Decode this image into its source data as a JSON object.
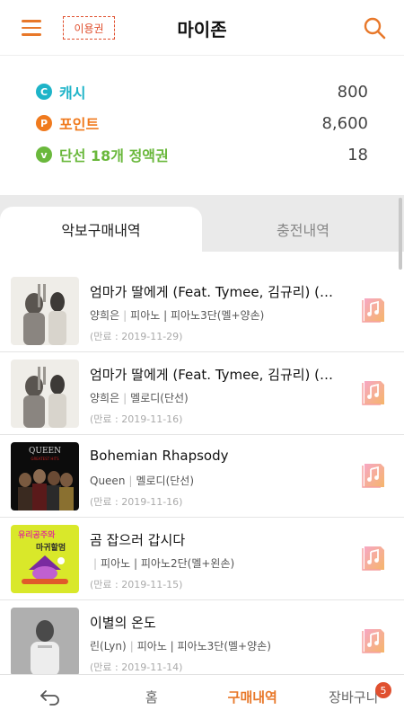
{
  "header": {
    "title": "마이존",
    "voucher_label": "이용권",
    "menu_icon": "hamburger-menu-icon",
    "search_icon": "search-icon",
    "accent": "#e8782a"
  },
  "balance": [
    {
      "icon_letter": "C",
      "label": "캐시",
      "value": "800",
      "color": "#1eb4c8"
    },
    {
      "icon_letter": "P",
      "label": "포인트",
      "value": "8,600",
      "color": "#f07a1e"
    },
    {
      "icon_letter": "v",
      "label": "단선 18개 정액권",
      "value": "18",
      "color": "#6ab83c"
    }
  ],
  "tabs": [
    {
      "label": "악보구매내역",
      "active": true
    },
    {
      "label": "충전내역",
      "active": false
    }
  ],
  "purchases": [
    {
      "title": "엄마가 딸에게 (Feat. Tymee, 김규리) (Ra…",
      "artist": "양희은",
      "meta": "피아노 | 피아노3단(멜+양손)",
      "date": "(만료 : 2019-11-29)",
      "thumb": "album-yang-icon"
    },
    {
      "title": "엄마가 딸에게 (Feat. Tymee, 김규리) (Ra…",
      "artist": "양희은",
      "meta": "멜로디(단선)",
      "date": "(만료 : 2019-11-16)",
      "thumb": "album-yang-icon"
    },
    {
      "title": "Bohemian Rhapsody",
      "artist": "Queen",
      "meta": "멜로디(단선)",
      "date": "(만료 : 2019-11-16)",
      "thumb": "album-queen-icon"
    },
    {
      "title": "곰 잡으러 갑시다",
      "artist": "",
      "meta": "피아노 | 피아노2단(멜+왼손)",
      "date": "(만료 : 2019-11-15)",
      "thumb": "album-princess-icon"
    },
    {
      "title": "이별의 온도",
      "artist": "린(Lyn)",
      "meta": "피아노 | 피아노3단(멜+양손)",
      "date": "(만료 : 2019-11-14)",
      "thumb": "album-lyn-icon"
    }
  ],
  "album_text": {
    "queen_band": "QUEEN",
    "queen_sub": "GREATEST HITS",
    "princess_top": "유리공주와",
    "princess_bottom": "마귀할멈"
  },
  "bottom_nav": [
    {
      "label": "",
      "icon": "back-arrow-icon"
    },
    {
      "label": "홈"
    },
    {
      "label": "구매내역",
      "active": true
    },
    {
      "label": "장바구니",
      "badge": "5"
    }
  ]
}
